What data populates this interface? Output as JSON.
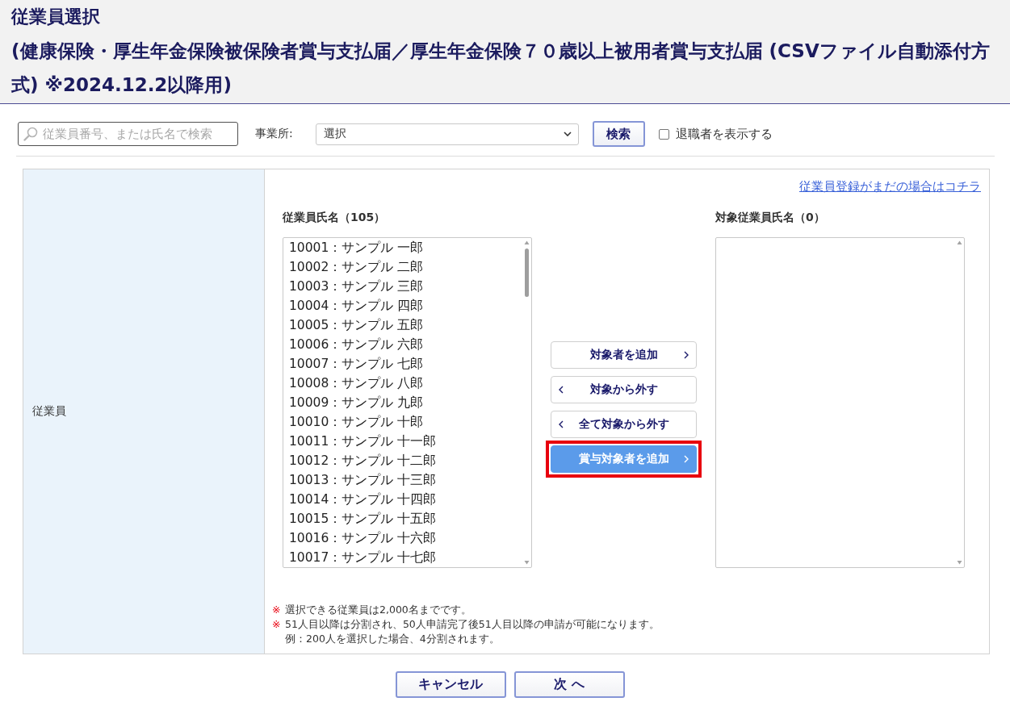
{
  "header": {
    "title": "従業員選択",
    "subtitle": "(健康保険・厚生年金保険被保険者賞与支払届／厚生年金保険７０歳以上被用者賞与支払届 (CSVファイル自動添付方式) ※2024.12.2以降用)"
  },
  "toolbar": {
    "search": {
      "placeholder": "従業員番号、または氏名で検索"
    },
    "office": {
      "label": "事業所:",
      "value": "選択"
    },
    "search_button": "検索",
    "show_retired": {
      "label": "退職者を表示する",
      "checked": false
    }
  },
  "form": {
    "row_label": "従業員",
    "register_link": "従業員登録がまだの場合はコチラ",
    "available": {
      "heading": "従業員氏名（105）",
      "items": [
        {
          "label": "10001：サンプル 一郎",
          "selected": false
        },
        {
          "label": "10002：サンプル 二郎",
          "selected": false
        },
        {
          "label": "10003：サンプル 三郎",
          "selected": false
        },
        {
          "label": "10004：サンプル 四郎",
          "selected": false
        },
        {
          "label": "10005：サンプル 五郎",
          "selected": false
        },
        {
          "label": "10006：サンプル 六郎",
          "selected": false
        },
        {
          "label": "10007：サンプル 七郎",
          "selected": false
        },
        {
          "label": "10008：サンプル 八郎",
          "selected": false
        },
        {
          "label": "10009：サンプル 九郎",
          "selected": false
        },
        {
          "label": "10010：サンプル 十郎",
          "selected": false
        },
        {
          "label": "10011：サンプル 十一郎",
          "selected": false
        },
        {
          "label": "10012：サンプル 十二郎",
          "selected": false
        },
        {
          "label": "10013：サンプル 十三郎",
          "selected": false
        },
        {
          "label": "10014：サンプル 十四郎",
          "selected": false
        },
        {
          "label": "10015：サンプル 十五郎",
          "selected": false
        },
        {
          "label": "10016：サンプル 十六郎",
          "selected": false
        },
        {
          "label": "10017：サンプル 十七郎",
          "selected": false
        }
      ]
    },
    "target": {
      "heading": "対象従業員氏名（0）"
    },
    "transfer_buttons": [
      {
        "label": "対象者を追加",
        "kind": "add",
        "primary": false,
        "highlighted": false
      },
      {
        "label": "対象から外す",
        "kind": "remove",
        "primary": false,
        "highlighted": false
      },
      {
        "label": "全て対象から外す",
        "kind": "remove",
        "primary": false,
        "highlighted": false
      },
      {
        "label": "賞与対象者を追加",
        "kind": "add",
        "primary": true,
        "highlighted": true
      }
    ],
    "notes": [
      {
        "mark": "※",
        "text": "選択できる従業員は2,000名までです。"
      },
      {
        "mark": "※",
        "text": "51人目以降は分割され、50人申請完了後51人目以降の申請が可能になります。"
      },
      {
        "text": "例：200人を選択した場合、4分割されます。"
      }
    ]
  },
  "footer_buttons": [
    "キャンセル",
    "次 へ"
  ]
}
